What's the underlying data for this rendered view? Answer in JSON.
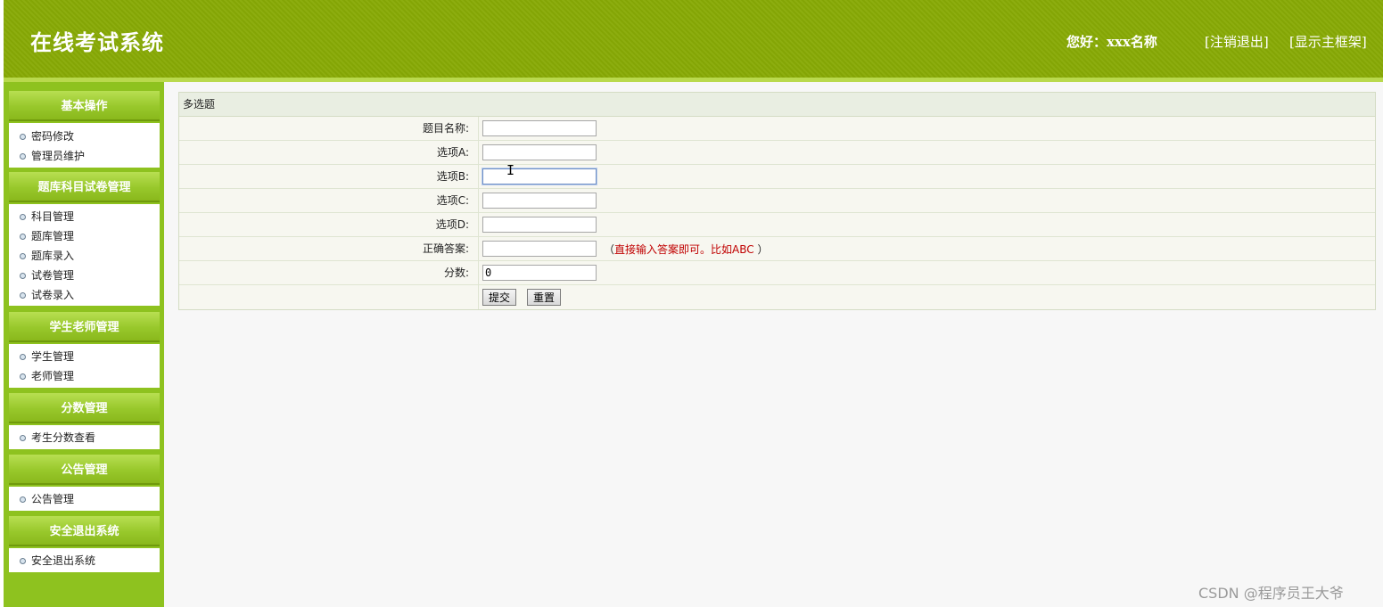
{
  "header": {
    "title": "在线考试系统",
    "greeting": "您好：xxx名称",
    "logout": "[注销退出]",
    "show_frame": "[显示主框架]"
  },
  "sidebar": {
    "groups": [
      {
        "title": "基本操作",
        "items": [
          "密码修改",
          "管理员维护"
        ]
      },
      {
        "title": "题库科目试卷管理",
        "items": [
          "科目管理",
          "题库管理",
          "题库录入",
          "试卷管理",
          "试卷录入"
        ]
      },
      {
        "title": "学生老师管理",
        "items": [
          "学生管理",
          "老师管理"
        ]
      },
      {
        "title": "分数管理",
        "items": [
          "考生分数查看"
        ]
      },
      {
        "title": "公告管理",
        "items": [
          "公告管理"
        ]
      },
      {
        "title": "安全退出系统",
        "items": [
          "安全退出系统"
        ]
      }
    ]
  },
  "form": {
    "title": "多选题",
    "fields": {
      "name": {
        "label": "题目名称:",
        "value": ""
      },
      "option_a": {
        "label": "选项A:",
        "value": ""
      },
      "option_b": {
        "label": "选项B:",
        "value": ""
      },
      "option_c": {
        "label": "选项C:",
        "value": ""
      },
      "option_d": {
        "label": "选项D:",
        "value": ""
      },
      "answer": {
        "label": "正确答案:",
        "value": "",
        "hint_open": "（",
        "hint": "直接输入答案即可。比如ABC",
        "hint_close": "）"
      },
      "score": {
        "label": "分数:",
        "value": "0"
      }
    },
    "submit": "提交",
    "reset": "重置"
  },
  "watermark": "CSDN @程序员王大爷",
  "colors": {
    "header_bg": "#88aa05",
    "sidebar_bg": "#8ec21f",
    "hint": "#c00000"
  }
}
